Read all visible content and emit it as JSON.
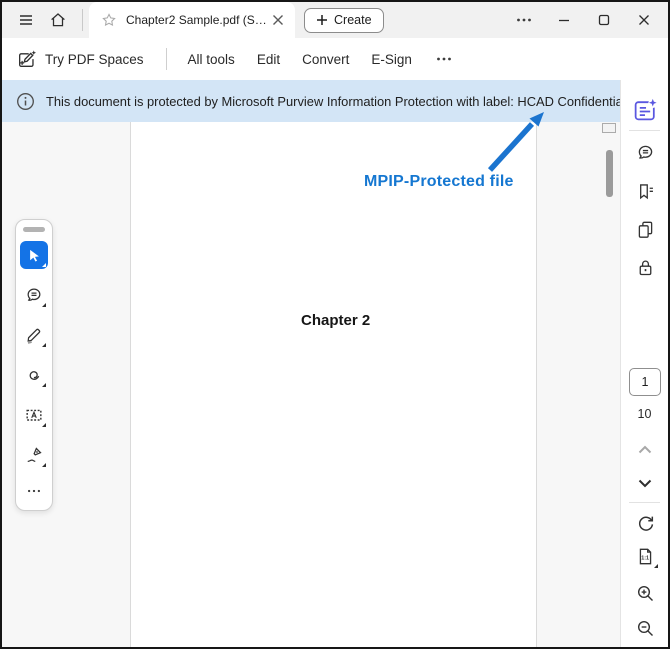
{
  "window": {
    "tab_title": "Chapter2 Sample.pdf (S…",
    "create_label": "Create"
  },
  "toolbar": {
    "try_pdf_spaces_label": "Try PDF Spaces",
    "menu": [
      "All tools",
      "Edit",
      "Convert",
      "E-Sign"
    ]
  },
  "banner": {
    "text": "This document is protected by Microsoft Purview Information Protection with label: HCAD Confidential"
  },
  "document": {
    "heading": "Chapter 2",
    "annotation": "MPIP-Protected file"
  },
  "pager": {
    "current": "1",
    "total": "10"
  },
  "zoom_controls": {
    "fit_label": "1:1"
  },
  "colors": {
    "accent_blue": "#1473e6",
    "banner_bg": "#d3e5f6",
    "annotation_blue": "#1577d1",
    "ai_purple": "#5a57e0",
    "tabbar_bg": "#f1f1f1"
  },
  "icons": [
    "hamburger",
    "home",
    "star",
    "close-tab",
    "plus",
    "more-options",
    "minimize",
    "maximize",
    "close-window",
    "pdf-spaces",
    "info",
    "select-cursor",
    "comment",
    "highlight",
    "draw",
    "text-box",
    "fill-sign",
    "ai-assistant",
    "comments-panel",
    "bookmarks",
    "page-thumbnails",
    "protection-lock",
    "page-up",
    "page-down",
    "rotate",
    "fit-page",
    "zoom-in",
    "zoom-out"
  ]
}
